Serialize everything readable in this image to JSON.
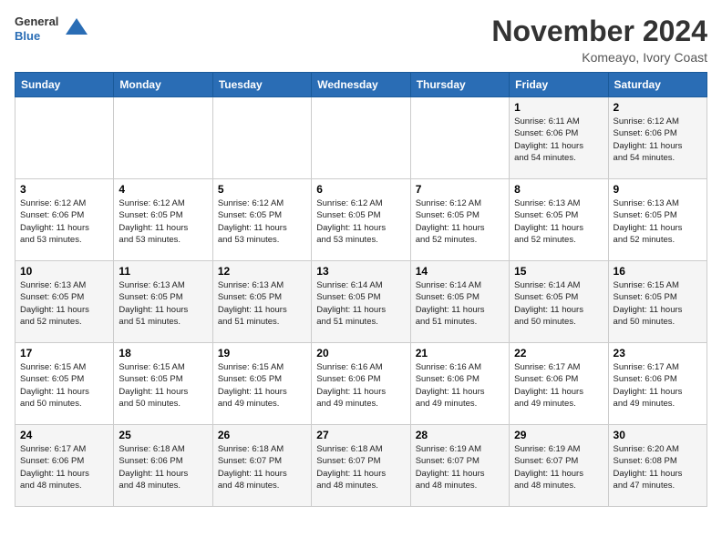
{
  "header": {
    "logo_line1": "General",
    "logo_line2": "Blue",
    "month": "November 2024",
    "location": "Komeayo, Ivory Coast"
  },
  "weekdays": [
    "Sunday",
    "Monday",
    "Tuesday",
    "Wednesday",
    "Thursday",
    "Friday",
    "Saturday"
  ],
  "weeks": [
    [
      {
        "day": "",
        "info": ""
      },
      {
        "day": "",
        "info": ""
      },
      {
        "day": "",
        "info": ""
      },
      {
        "day": "",
        "info": ""
      },
      {
        "day": "",
        "info": ""
      },
      {
        "day": "1",
        "info": "Sunrise: 6:11 AM\nSunset: 6:06 PM\nDaylight: 11 hours\nand 54 minutes."
      },
      {
        "day": "2",
        "info": "Sunrise: 6:12 AM\nSunset: 6:06 PM\nDaylight: 11 hours\nand 54 minutes."
      }
    ],
    [
      {
        "day": "3",
        "info": "Sunrise: 6:12 AM\nSunset: 6:06 PM\nDaylight: 11 hours\nand 53 minutes."
      },
      {
        "day": "4",
        "info": "Sunrise: 6:12 AM\nSunset: 6:05 PM\nDaylight: 11 hours\nand 53 minutes."
      },
      {
        "day": "5",
        "info": "Sunrise: 6:12 AM\nSunset: 6:05 PM\nDaylight: 11 hours\nand 53 minutes."
      },
      {
        "day": "6",
        "info": "Sunrise: 6:12 AM\nSunset: 6:05 PM\nDaylight: 11 hours\nand 53 minutes."
      },
      {
        "day": "7",
        "info": "Sunrise: 6:12 AM\nSunset: 6:05 PM\nDaylight: 11 hours\nand 52 minutes."
      },
      {
        "day": "8",
        "info": "Sunrise: 6:13 AM\nSunset: 6:05 PM\nDaylight: 11 hours\nand 52 minutes."
      },
      {
        "day": "9",
        "info": "Sunrise: 6:13 AM\nSunset: 6:05 PM\nDaylight: 11 hours\nand 52 minutes."
      }
    ],
    [
      {
        "day": "10",
        "info": "Sunrise: 6:13 AM\nSunset: 6:05 PM\nDaylight: 11 hours\nand 52 minutes."
      },
      {
        "day": "11",
        "info": "Sunrise: 6:13 AM\nSunset: 6:05 PM\nDaylight: 11 hours\nand 51 minutes."
      },
      {
        "day": "12",
        "info": "Sunrise: 6:13 AM\nSunset: 6:05 PM\nDaylight: 11 hours\nand 51 minutes."
      },
      {
        "day": "13",
        "info": "Sunrise: 6:14 AM\nSunset: 6:05 PM\nDaylight: 11 hours\nand 51 minutes."
      },
      {
        "day": "14",
        "info": "Sunrise: 6:14 AM\nSunset: 6:05 PM\nDaylight: 11 hours\nand 51 minutes."
      },
      {
        "day": "15",
        "info": "Sunrise: 6:14 AM\nSunset: 6:05 PM\nDaylight: 11 hours\nand 50 minutes."
      },
      {
        "day": "16",
        "info": "Sunrise: 6:15 AM\nSunset: 6:05 PM\nDaylight: 11 hours\nand 50 minutes."
      }
    ],
    [
      {
        "day": "17",
        "info": "Sunrise: 6:15 AM\nSunset: 6:05 PM\nDaylight: 11 hours\nand 50 minutes."
      },
      {
        "day": "18",
        "info": "Sunrise: 6:15 AM\nSunset: 6:05 PM\nDaylight: 11 hours\nand 50 minutes."
      },
      {
        "day": "19",
        "info": "Sunrise: 6:15 AM\nSunset: 6:05 PM\nDaylight: 11 hours\nand 49 minutes."
      },
      {
        "day": "20",
        "info": "Sunrise: 6:16 AM\nSunset: 6:06 PM\nDaylight: 11 hours\nand 49 minutes."
      },
      {
        "day": "21",
        "info": "Sunrise: 6:16 AM\nSunset: 6:06 PM\nDaylight: 11 hours\nand 49 minutes."
      },
      {
        "day": "22",
        "info": "Sunrise: 6:17 AM\nSunset: 6:06 PM\nDaylight: 11 hours\nand 49 minutes."
      },
      {
        "day": "23",
        "info": "Sunrise: 6:17 AM\nSunset: 6:06 PM\nDaylight: 11 hours\nand 49 minutes."
      }
    ],
    [
      {
        "day": "24",
        "info": "Sunrise: 6:17 AM\nSunset: 6:06 PM\nDaylight: 11 hours\nand 48 minutes."
      },
      {
        "day": "25",
        "info": "Sunrise: 6:18 AM\nSunset: 6:06 PM\nDaylight: 11 hours\nand 48 minutes."
      },
      {
        "day": "26",
        "info": "Sunrise: 6:18 AM\nSunset: 6:07 PM\nDaylight: 11 hours\nand 48 minutes."
      },
      {
        "day": "27",
        "info": "Sunrise: 6:18 AM\nSunset: 6:07 PM\nDaylight: 11 hours\nand 48 minutes."
      },
      {
        "day": "28",
        "info": "Sunrise: 6:19 AM\nSunset: 6:07 PM\nDaylight: 11 hours\nand 48 minutes."
      },
      {
        "day": "29",
        "info": "Sunrise: 6:19 AM\nSunset: 6:07 PM\nDaylight: 11 hours\nand 48 minutes."
      },
      {
        "day": "30",
        "info": "Sunrise: 6:20 AM\nSunset: 6:08 PM\nDaylight: 11 hours\nand 47 minutes."
      }
    ]
  ]
}
